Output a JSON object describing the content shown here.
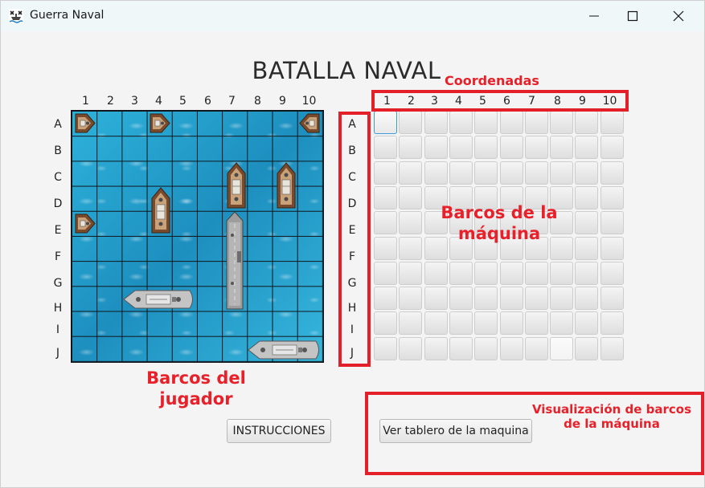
{
  "window": {
    "title": "Guerra Naval",
    "icon": "ship-app-icon",
    "controls": [
      "minimize-icon",
      "maximize-icon",
      "close-icon"
    ]
  },
  "heading": "BATALLA NAVAL",
  "columns": [
    "1",
    "2",
    "3",
    "4",
    "5",
    "6",
    "7",
    "8",
    "9",
    "10"
  ],
  "rows": [
    "A",
    "B",
    "C",
    "D",
    "E",
    "F",
    "G",
    "H",
    "I",
    "J"
  ],
  "player_board": {
    "ships": [
      {
        "type": "boat",
        "orientation": "horizontal",
        "cells": [
          "A1"
        ]
      },
      {
        "type": "boat",
        "orientation": "horizontal",
        "cells": [
          "A4"
        ]
      },
      {
        "type": "boat",
        "orientation": "horizontal",
        "cells": [
          "A10"
        ]
      },
      {
        "type": "boat",
        "orientation": "horizontal",
        "cells": [
          "E1"
        ]
      },
      {
        "type": "frigate",
        "orientation": "vertical",
        "cells": [
          "C7",
          "D7"
        ]
      },
      {
        "type": "frigate",
        "orientation": "vertical",
        "cells": [
          "C9",
          "D9"
        ]
      },
      {
        "type": "frigate",
        "orientation": "vertical",
        "cells": [
          "D4",
          "E4"
        ]
      },
      {
        "type": "destroyer",
        "orientation": "horizontal",
        "cells": [
          "H3",
          "H4",
          "H5"
        ]
      },
      {
        "type": "destroyer",
        "orientation": "horizontal",
        "cells": [
          "J8",
          "J9",
          "J10"
        ]
      },
      {
        "type": "carrier",
        "orientation": "vertical",
        "cells": [
          "E7",
          "F7",
          "G7",
          "H7"
        ]
      }
    ]
  },
  "machine_board": {
    "selected_cell": "A1",
    "highlighted_cells": [
      "J8"
    ]
  },
  "annotations": {
    "coordinates": "Coordenadas",
    "machine_ships_line1": "Barcos de la",
    "machine_ships_line2": "máquina",
    "player_ships_line1": "Barcos del",
    "player_ships_line2": "jugador",
    "view_line1": "Visualización de barcos",
    "view_line2": "de la máquina"
  },
  "buttons": {
    "instructions": "INSTRUCCIONES",
    "view_machine_board": "Ver tablero de la maquina"
  },
  "colors": {
    "annotation_red": "#e3202a",
    "water": "#29a8d2",
    "grid_line": "#10161b"
  }
}
